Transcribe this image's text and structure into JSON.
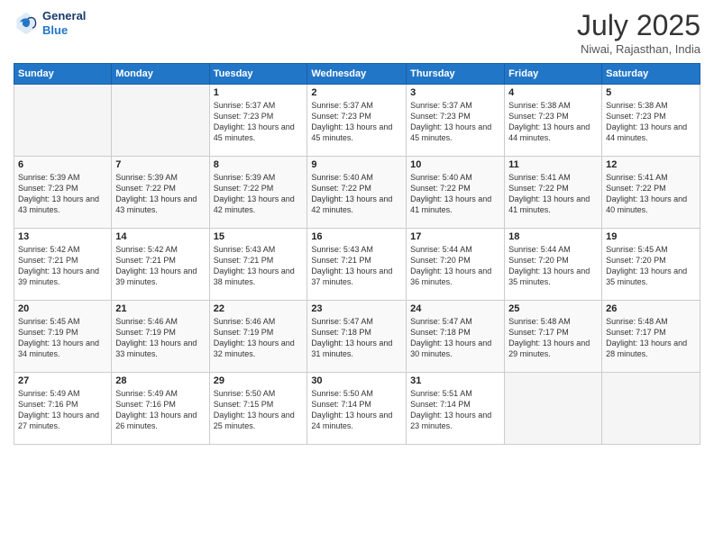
{
  "header": {
    "logo_line1": "General",
    "logo_line2": "Blue",
    "month": "July 2025",
    "location": "Niwai, Rajasthan, India"
  },
  "days_of_week": [
    "Sunday",
    "Monday",
    "Tuesday",
    "Wednesday",
    "Thursday",
    "Friday",
    "Saturday"
  ],
  "weeks": [
    [
      {
        "day": "",
        "info": ""
      },
      {
        "day": "",
        "info": ""
      },
      {
        "day": "1",
        "info": "Sunrise: 5:37 AM\nSunset: 7:23 PM\nDaylight: 13 hours and 45 minutes."
      },
      {
        "day": "2",
        "info": "Sunrise: 5:37 AM\nSunset: 7:23 PM\nDaylight: 13 hours and 45 minutes."
      },
      {
        "day": "3",
        "info": "Sunrise: 5:37 AM\nSunset: 7:23 PM\nDaylight: 13 hours and 45 minutes."
      },
      {
        "day": "4",
        "info": "Sunrise: 5:38 AM\nSunset: 7:23 PM\nDaylight: 13 hours and 44 minutes."
      },
      {
        "day": "5",
        "info": "Sunrise: 5:38 AM\nSunset: 7:23 PM\nDaylight: 13 hours and 44 minutes."
      }
    ],
    [
      {
        "day": "6",
        "info": "Sunrise: 5:39 AM\nSunset: 7:23 PM\nDaylight: 13 hours and 43 minutes."
      },
      {
        "day": "7",
        "info": "Sunrise: 5:39 AM\nSunset: 7:22 PM\nDaylight: 13 hours and 43 minutes."
      },
      {
        "day": "8",
        "info": "Sunrise: 5:39 AM\nSunset: 7:22 PM\nDaylight: 13 hours and 42 minutes."
      },
      {
        "day": "9",
        "info": "Sunrise: 5:40 AM\nSunset: 7:22 PM\nDaylight: 13 hours and 42 minutes."
      },
      {
        "day": "10",
        "info": "Sunrise: 5:40 AM\nSunset: 7:22 PM\nDaylight: 13 hours and 41 minutes."
      },
      {
        "day": "11",
        "info": "Sunrise: 5:41 AM\nSunset: 7:22 PM\nDaylight: 13 hours and 41 minutes."
      },
      {
        "day": "12",
        "info": "Sunrise: 5:41 AM\nSunset: 7:22 PM\nDaylight: 13 hours and 40 minutes."
      }
    ],
    [
      {
        "day": "13",
        "info": "Sunrise: 5:42 AM\nSunset: 7:21 PM\nDaylight: 13 hours and 39 minutes."
      },
      {
        "day": "14",
        "info": "Sunrise: 5:42 AM\nSunset: 7:21 PM\nDaylight: 13 hours and 39 minutes."
      },
      {
        "day": "15",
        "info": "Sunrise: 5:43 AM\nSunset: 7:21 PM\nDaylight: 13 hours and 38 minutes."
      },
      {
        "day": "16",
        "info": "Sunrise: 5:43 AM\nSunset: 7:21 PM\nDaylight: 13 hours and 37 minutes."
      },
      {
        "day": "17",
        "info": "Sunrise: 5:44 AM\nSunset: 7:20 PM\nDaylight: 13 hours and 36 minutes."
      },
      {
        "day": "18",
        "info": "Sunrise: 5:44 AM\nSunset: 7:20 PM\nDaylight: 13 hours and 35 minutes."
      },
      {
        "day": "19",
        "info": "Sunrise: 5:45 AM\nSunset: 7:20 PM\nDaylight: 13 hours and 35 minutes."
      }
    ],
    [
      {
        "day": "20",
        "info": "Sunrise: 5:45 AM\nSunset: 7:19 PM\nDaylight: 13 hours and 34 minutes."
      },
      {
        "day": "21",
        "info": "Sunrise: 5:46 AM\nSunset: 7:19 PM\nDaylight: 13 hours and 33 minutes."
      },
      {
        "day": "22",
        "info": "Sunrise: 5:46 AM\nSunset: 7:19 PM\nDaylight: 13 hours and 32 minutes."
      },
      {
        "day": "23",
        "info": "Sunrise: 5:47 AM\nSunset: 7:18 PM\nDaylight: 13 hours and 31 minutes."
      },
      {
        "day": "24",
        "info": "Sunrise: 5:47 AM\nSunset: 7:18 PM\nDaylight: 13 hours and 30 minutes."
      },
      {
        "day": "25",
        "info": "Sunrise: 5:48 AM\nSunset: 7:17 PM\nDaylight: 13 hours and 29 minutes."
      },
      {
        "day": "26",
        "info": "Sunrise: 5:48 AM\nSunset: 7:17 PM\nDaylight: 13 hours and 28 minutes."
      }
    ],
    [
      {
        "day": "27",
        "info": "Sunrise: 5:49 AM\nSunset: 7:16 PM\nDaylight: 13 hours and 27 minutes."
      },
      {
        "day": "28",
        "info": "Sunrise: 5:49 AM\nSunset: 7:16 PM\nDaylight: 13 hours and 26 minutes."
      },
      {
        "day": "29",
        "info": "Sunrise: 5:50 AM\nSunset: 7:15 PM\nDaylight: 13 hours and 25 minutes."
      },
      {
        "day": "30",
        "info": "Sunrise: 5:50 AM\nSunset: 7:14 PM\nDaylight: 13 hours and 24 minutes."
      },
      {
        "day": "31",
        "info": "Sunrise: 5:51 AM\nSunset: 7:14 PM\nDaylight: 13 hours and 23 minutes."
      },
      {
        "day": "",
        "info": ""
      },
      {
        "day": "",
        "info": ""
      }
    ]
  ]
}
